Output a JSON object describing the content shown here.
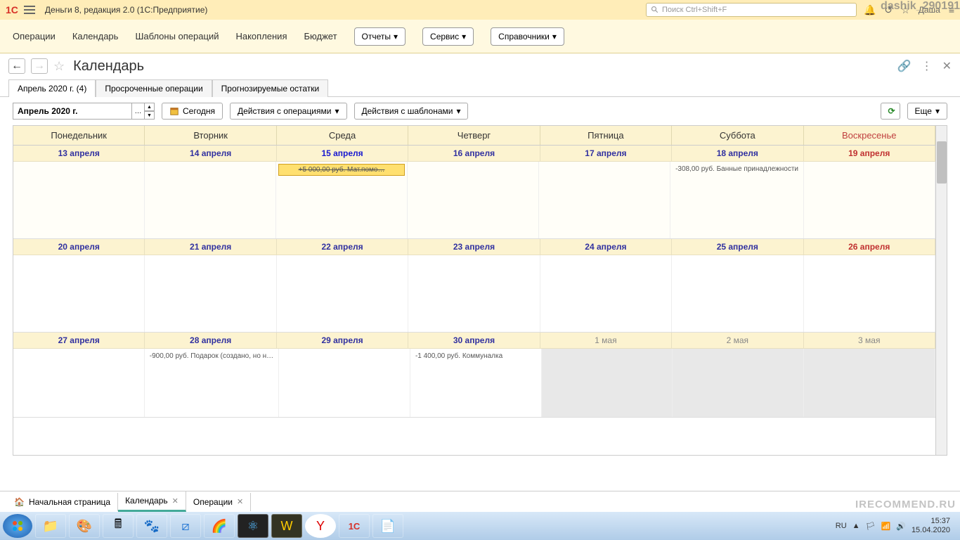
{
  "titlebar": {
    "app": "Деньги 8, редакция 2.0  (1С:Предприятие)",
    "search_ph": "Поиск Ctrl+Shift+F",
    "user": "Даша"
  },
  "watermark_user": "dashik_290191",
  "menu": {
    "i0": "Операции",
    "i1": "Календарь",
    "i2": "Шаблоны операций",
    "i3": "Накопления",
    "i4": "Бюджет",
    "b0": "Отчеты",
    "b1": "Сервис",
    "b2": "Справочники"
  },
  "page_title": "Календарь",
  "tabs": {
    "t0": "Апрель 2020 г. (4)",
    "t1": "Просроченные операции",
    "t2": "Прогнозируемые остатки"
  },
  "toolbar": {
    "month": "Апрель 2020 г.",
    "today": "Сегодня",
    "act_ops": "Действия с операциями",
    "act_tpl": "Действия с шаблонами",
    "more": "Еще"
  },
  "weekdays": {
    "d0": "Понедельник",
    "d1": "Вторник",
    "d2": "Среда",
    "d3": "Четверг",
    "d4": "Пятница",
    "d5": "Суббота",
    "d6": "Воскресенье"
  },
  "week1": {
    "c0": "13 апреля",
    "c1": "14 апреля",
    "c2": "15 апреля",
    "c3": "16 апреля",
    "c4": "17 апреля",
    "c5": "18 апреля",
    "c6": "19 апреля"
  },
  "week2": {
    "c0": "20 апреля",
    "c1": "21 апреля",
    "c2": "22 апреля",
    "c3": "23 апреля",
    "c4": "24 апреля",
    "c5": "25 апреля",
    "c6": "26 апреля"
  },
  "week3": {
    "c0": "27 апреля",
    "c1": "28 апреля",
    "c2": "29 апреля",
    "c3": "30 апреля",
    "c4": "1 мая",
    "c5": "2 мая",
    "c6": "3 мая"
  },
  "events": {
    "e1": "+5 000,00 руб. Мат.помо…",
    "e2": "-308,00 руб. Банные принадлежности",
    "e3": "-900,00 руб. Подарок (создано, но н…",
    "e4": "-1 400,00 руб. Коммуналка"
  },
  "bottom": {
    "b0": "Начальная страница",
    "b1": "Календарь",
    "b2": "Операции"
  },
  "tray": {
    "lang": "RU",
    "time": "15:37",
    "date": "15.04.2020"
  },
  "site_watermark": "IRECOMMEND.RU"
}
